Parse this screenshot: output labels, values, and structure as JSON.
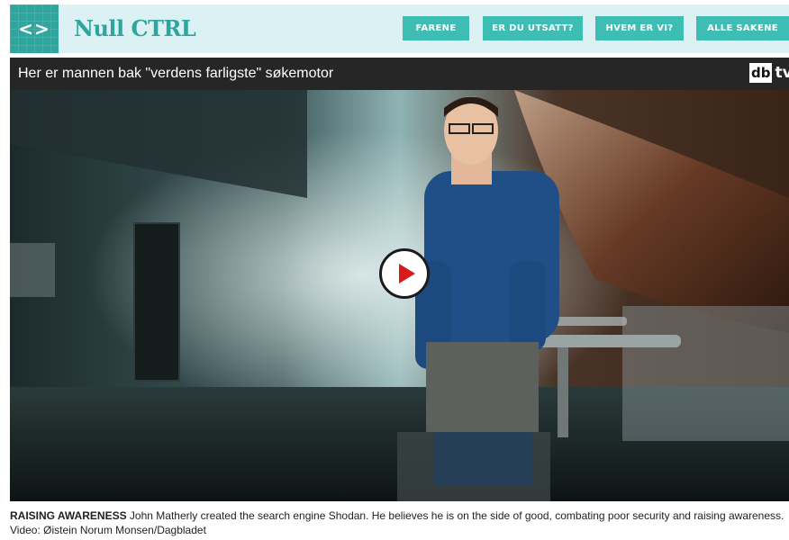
{
  "header": {
    "logo_glyph": "<>",
    "site_title": "Null CTRL",
    "accent_color": "#2fa59d",
    "nav": [
      "FARENE",
      "ER DU UTSATT?",
      "HVEM ER VI?",
      "ALLE SAKENE"
    ]
  },
  "video": {
    "title": "Her er mannen bak \"verdens farligste\" søkemotor",
    "brand_db": "db",
    "brand_tv": "tv",
    "play_icon": "play-icon"
  },
  "caption": {
    "lead": "RAISING AWARENESS",
    "text": " John Matherly created the search engine Shodan. He believes he is on the side of good, combating poor security and raising awareness. Video: Øistein Norum Monsen/Dagbladet"
  }
}
